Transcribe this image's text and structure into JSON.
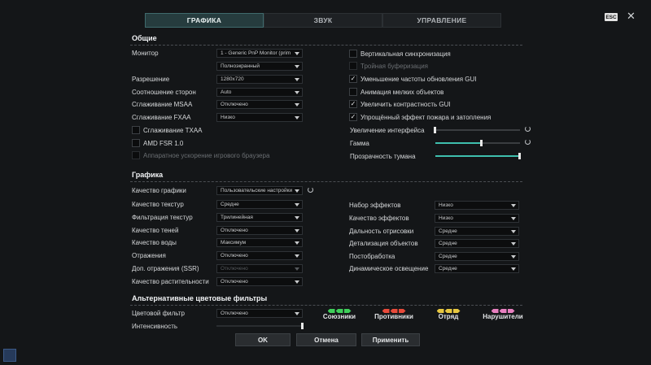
{
  "tabs": [
    {
      "label": "ГРАФИКА",
      "active": true
    },
    {
      "label": "ЗВУК",
      "active": false
    },
    {
      "label": "УПРАВЛЕНИЕ",
      "active": false
    }
  ],
  "esc_label": "ESC",
  "general": {
    "title": "Общие",
    "monitor": {
      "label": "Монитор",
      "value": "1 - Generic PnP Monitor (prim"
    },
    "mode": {
      "value": "Полноэкранный"
    },
    "resolution": {
      "label": "Разрешение",
      "value": "1280x720"
    },
    "aspect": {
      "label": "Соотношение сторон",
      "value": "Auto"
    },
    "msaa": {
      "label": "Сглаживание MSAA",
      "value": "Отключено"
    },
    "fxaa": {
      "label": "Сглаживание FXAA",
      "value": "Низко"
    },
    "txaa": {
      "label": "Сглаживание TXAA",
      "checked": false
    },
    "fsr": {
      "label": "AMD FSR 1.0",
      "checked": false
    },
    "browser_accel": {
      "label": "Аппаратное ускорение игрового браузера",
      "checked": false,
      "disabled": true
    },
    "vsync": {
      "label": "Вертикальная синхронизация",
      "checked": false
    },
    "triple_buffer": {
      "label": "Тройная буферизация",
      "checked": false,
      "disabled": true
    },
    "gui_rate": {
      "label": "Уменьшение частоты обновления GUI",
      "checked": true
    },
    "small_anim": {
      "label": "Анимация мелких объектов",
      "checked": false
    },
    "contrast": {
      "label": "Увеличить контрастность GUI",
      "checked": true
    },
    "fire_effect": {
      "label": "Упрощённый эффект пожара и затопления",
      "checked": true
    },
    "ui_scale": {
      "label": "Увеличение интерфейса",
      "value": 0.0
    },
    "gamma": {
      "label": "Гамма",
      "value": 0.55
    },
    "fog": {
      "label": "Прозрачность тумана",
      "value": 1.0
    }
  },
  "graphics": {
    "title": "Графика",
    "quality": {
      "label": "Качество графики",
      "value": "Пользовательские настройки"
    },
    "textures": {
      "label": "Качество текстур",
      "value": "Средне"
    },
    "filtering": {
      "label": "Фильтрация текстур",
      "value": "Трилинейная"
    },
    "shadows": {
      "label": "Качество теней",
      "value": "Отключено"
    },
    "water": {
      "label": "Качество воды",
      "value": "Максимум"
    },
    "reflections": {
      "label": "Отражения",
      "value": "Отключено"
    },
    "ssr": {
      "label": "Доп. отражения (SSR)",
      "value": "Отключено"
    },
    "vegetation": {
      "label": "Качество растительности",
      "value": "Отключено"
    },
    "effects_set": {
      "label": "Набор эффектов",
      "value": "Низко"
    },
    "effects_quality": {
      "label": "Качество эффектов",
      "value": "Низко"
    },
    "draw_distance": {
      "label": "Дальность отрисовки",
      "value": "Средне"
    },
    "object_detail": {
      "label": "Детализация объектов",
      "value": "Средне"
    },
    "postprocess": {
      "label": "Постобработка",
      "value": "Средне"
    },
    "dynamic_light": {
      "label": "Динамическое освещение",
      "value": "Средне"
    }
  },
  "filters": {
    "title": "Альтернативные цветовые фильтры",
    "color_filter": {
      "label": "Цветовой фильтр",
      "value": "Отключено"
    },
    "intensity": {
      "label": "Интенсивность",
      "value": 1.0
    },
    "legend": [
      {
        "label": "Союзники",
        "color": "#3fcf5a"
      },
      {
        "label": "Противники",
        "color": "#e84a3a"
      },
      {
        "label": "Отряд",
        "color": "#e8c840"
      },
      {
        "label": "Нарушители",
        "color": "#e880c0"
      }
    ]
  },
  "buttons": {
    "ok": "OK",
    "cancel": "Отмена",
    "apply": "Применить"
  }
}
